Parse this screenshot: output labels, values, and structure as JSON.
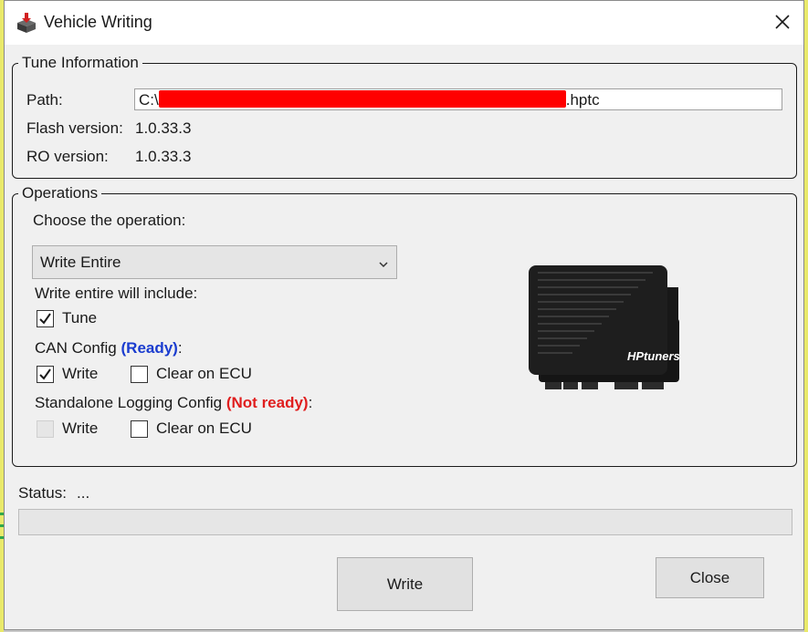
{
  "window": {
    "title": "Vehicle Writing",
    "icon": "app-box-icon",
    "close_icon": "close-icon"
  },
  "tune_info": {
    "legend": "Tune Information",
    "path_label": "Path:",
    "path_prefix": "C:\\",
    "path_suffix": ".hptc",
    "flash_label": "Flash version:",
    "flash_value": "1.0.33.3",
    "ro_label": "RO version:",
    "ro_value": "1.0.33.3"
  },
  "operations": {
    "legend": "Operations",
    "choose_label": "Choose the operation:",
    "selected": "Write Entire",
    "include_label": "Write entire will include:",
    "tune_checkbox": {
      "label": "Tune",
      "checked": true
    },
    "can_config": {
      "label": "CAN Config",
      "status": "(Ready)",
      "suffix": ":",
      "write": {
        "label": "Write",
        "checked": true
      },
      "clear": {
        "label": "Clear on ECU",
        "checked": false
      }
    },
    "standalone": {
      "label": "Standalone Logging Config",
      "status": "(Not ready)",
      "suffix": ":",
      "write": {
        "label": "Write",
        "checked": false,
        "disabled": true
      },
      "clear": {
        "label": "Clear on ECU",
        "checked": false
      }
    },
    "device_logo": "HPtuners"
  },
  "status": {
    "label": "Status:",
    "value": "...",
    "progress": 0
  },
  "buttons": {
    "write": "Write",
    "close": "Close"
  },
  "colors": {
    "ready": "#1a3ccf",
    "not_ready": "#e01e1e",
    "redaction": "#ff0000"
  }
}
